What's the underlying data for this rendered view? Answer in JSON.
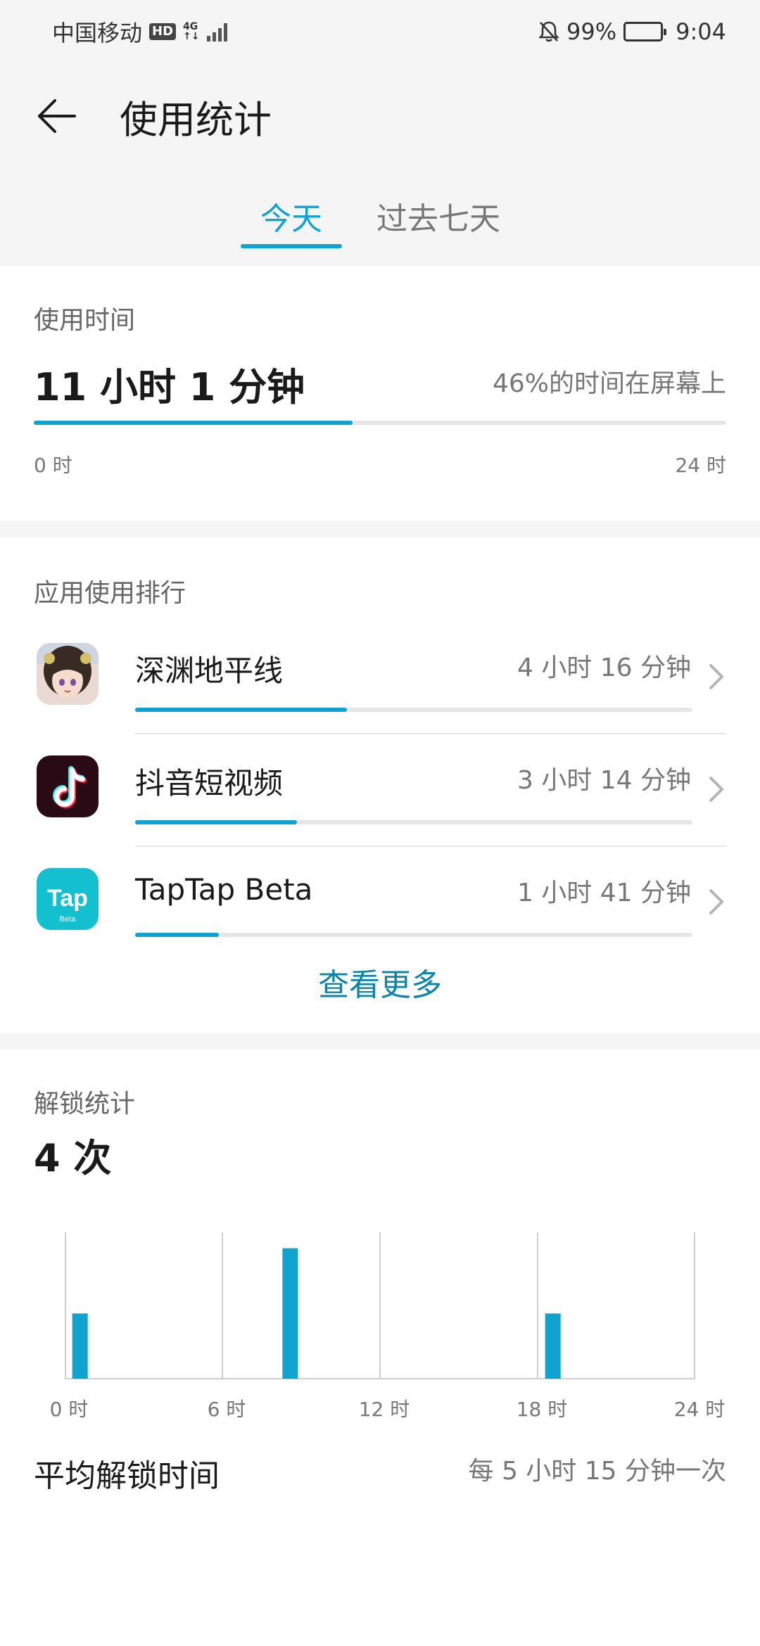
{
  "status_bar": {
    "carrier": "中国移动",
    "hd": "HD",
    "network": "4G",
    "network_sub": "↑↓",
    "battery": "99%",
    "time": "9:04"
  },
  "header": {
    "title": "使用统计"
  },
  "tabs": [
    {
      "label": "今天",
      "active": true
    },
    {
      "label": "过去七天",
      "active": false
    }
  ],
  "usage": {
    "section_title": "使用时间",
    "total": "11 小时 1 分钟",
    "screen_ratio": "46%的时间在屏幕上",
    "progress_fraction": 0.46,
    "axis_start": "0 时",
    "axis_end": "24 时"
  },
  "ranking": {
    "section_title": "应用使用排行",
    "apps": [
      {
        "name": "深渊地平线",
        "time": "4 小时 16 分钟",
        "fraction": 0.38,
        "icon": "anime-girl-icon"
      },
      {
        "name": "抖音短视频",
        "time": "3 小时 14 分钟",
        "fraction": 0.29,
        "icon": "tiktok-icon"
      },
      {
        "name": "TapTap Beta",
        "time": "1 小时 41 分钟",
        "fraction": 0.15,
        "icon": "taptap-icon"
      }
    ],
    "see_more": "查看更多",
    "taptap_logo": "Tap",
    "taptap_badge": "Beta"
  },
  "unlock": {
    "section_title": "解锁统计",
    "count": "4 次",
    "avg_label": "平均解锁时间",
    "avg_value": "每 5 小时 15 分钟一次",
    "accent_color": "#0fa3d0"
  },
  "chart_data": {
    "type": "bar",
    "x_ticks": [
      "0 时",
      "6 时",
      "12 时",
      "18 时",
      "24 时"
    ],
    "xlim": [
      0,
      24
    ],
    "ylim": [
      0,
      2.2
    ],
    "bars": [
      {
        "hour": 0.5,
        "value": 1
      },
      {
        "hour": 8.5,
        "value": 2
      },
      {
        "hour": 18.5,
        "value": 1
      }
    ],
    "grid": true
  }
}
